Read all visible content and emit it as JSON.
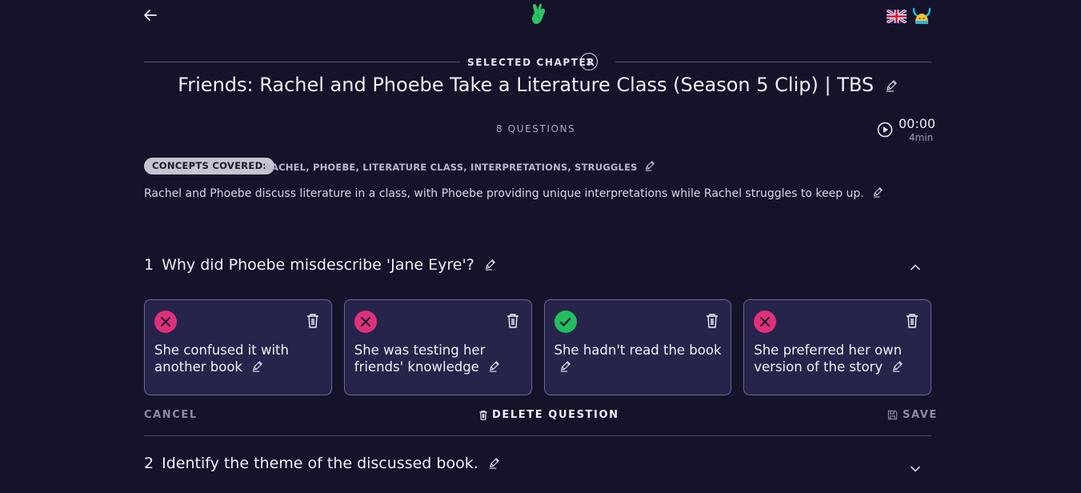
{
  "header": {
    "back_icon": "arrow-left-icon",
    "logo_icon": "hand-logo-icon",
    "language_flag": "uk-flag-icon",
    "avatar_icon": "viking-helmet-avatar-icon"
  },
  "chapter": {
    "label": "SELECTED CHAPTER",
    "number": "1",
    "title": "Friends: Rachel and Phoebe Take a Literature Class (Season 5 Clip) | TBS",
    "questions_count": "8 QUESTIONS",
    "time": "00:00",
    "duration": "4min"
  },
  "concepts": {
    "label": "CONCEPTS COVERED:",
    "list": "RACHEL, PHOEBE, LITERATURE CLASS, INTERPRETATIONS, STRUGGLES"
  },
  "summary": "Rachel and Phoebe discuss literature in a class, with Phoebe providing unique interpretations while Rachel struggles to keep up.",
  "questions": [
    {
      "number": "1",
      "text": "Why did Phoebe misdescribe 'Jane Eyre'?",
      "expanded": true,
      "answers": [
        {
          "text": "She confused it with another book",
          "correct": false
        },
        {
          "text": "She was testing her friends' knowledge",
          "correct": false
        },
        {
          "text": "She hadn't read the book",
          "correct": true
        },
        {
          "text": "She preferred her own version of the story",
          "correct": false
        }
      ],
      "actions": {
        "cancel": "CANCEL",
        "delete": "DELETE QUESTION",
        "save": "SAVE"
      }
    },
    {
      "number": "2",
      "text": "Identify the theme of the discussed book.",
      "expanded": false
    }
  ],
  "colors": {
    "background": "#14132a",
    "card": "#26244a",
    "wrong": "#e0307a",
    "correct": "#22bd5e",
    "logo": "#2ec462"
  }
}
